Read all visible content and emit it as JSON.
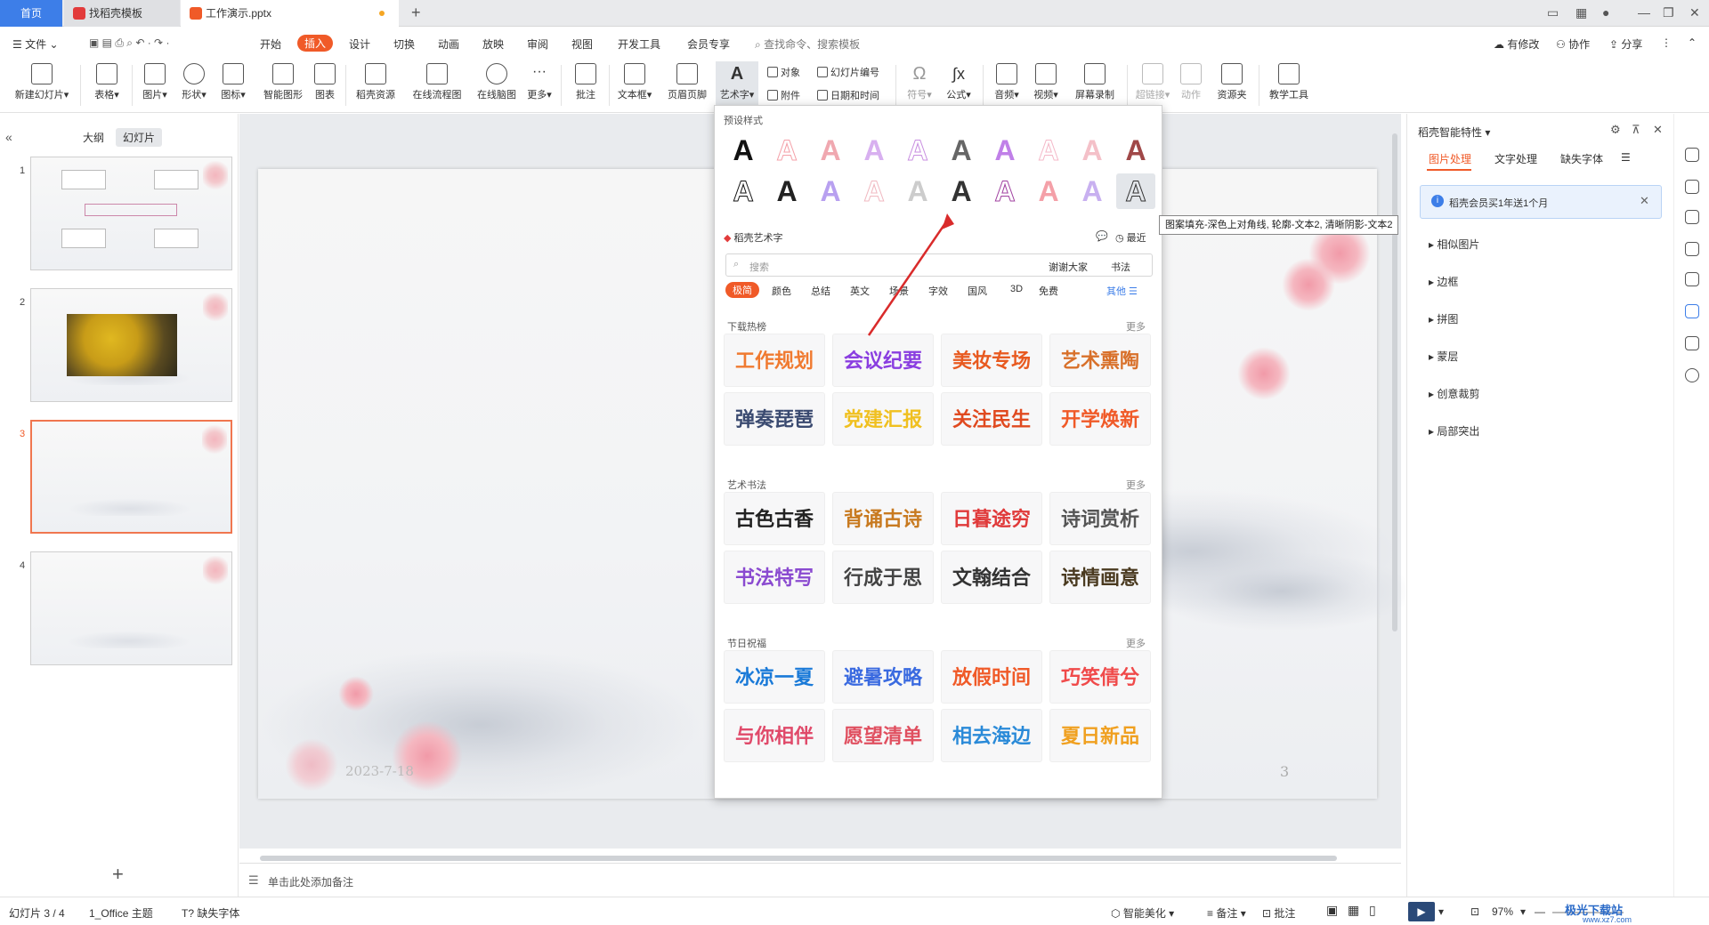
{
  "tabs": {
    "home": "首页",
    "t1": "找稻壳模板",
    "t2": "工作演示.pptx"
  },
  "menubar": {
    "file": "文件",
    "items": [
      "开始",
      "插入",
      "设计",
      "切换",
      "动画",
      "放映",
      "审阅",
      "视图",
      "开发工具",
      "会员专享"
    ],
    "search_placeholder": "查找命令、搜索模板",
    "modified": "有修改",
    "collab": "协作",
    "share": "分享"
  },
  "ribbon": {
    "new_slide": "新建幻灯片",
    "table": "表格",
    "image": "图片",
    "shape": "形状",
    "icon": "图标",
    "smart_graphic": "智能图形",
    "chart": "图表",
    "docer_res": "稻壳资源",
    "online_flow": "在线流程图",
    "online_mind": "在线脑图",
    "more": "更多",
    "comment": "批注",
    "textbox": "文本框",
    "header_footer": "页眉页脚",
    "wordart": "艺术字",
    "object": "对象",
    "attachment": "附件",
    "slide_number": "幻灯片编号",
    "datetime": "日期和时间",
    "symbol": "符号",
    "formula": "公式",
    "audio": "音频",
    "video": "视频",
    "screen_rec": "屏幕录制",
    "hyperlink": "超链接",
    "action": "动作",
    "resource": "资源夹",
    "teach_tool": "教学工具"
  },
  "leftpanel": {
    "tab_outline": "大纲",
    "tab_slides": "幻灯片",
    "slide_numbers": [
      "1",
      "2",
      "3",
      "4"
    ],
    "add_slide": "+"
  },
  "slide": {
    "date": "2023-7-18",
    "page_number": "3"
  },
  "notes": {
    "placeholder": "单击此处添加备注"
  },
  "dropdown": {
    "preset_title": "预设样式",
    "docer_title": "稻壳艺术字",
    "recent": "最近",
    "search_placeholder": "搜索",
    "search_btn1": "谢谢大家",
    "search_btn2": "书法",
    "categories": [
      "极简",
      "颜色",
      "总结",
      "英文",
      "场景",
      "字效",
      "国风",
      "3D",
      "免费"
    ],
    "other": "其他",
    "sections": [
      {
        "title": "下载热榜",
        "more": "更多",
        "cards": [
          "工作规划",
          "会议纪要",
          "美妆专场",
          "艺术熏陶",
          "弹奏琵琶",
          "党建汇报",
          "关注民生",
          "开学焕新"
        ]
      },
      {
        "title": "艺术书法",
        "more": "更多",
        "cards": [
          "古色古香",
          "背诵古诗",
          "日暮途穷",
          "诗词赏析",
          "书法特写",
          "行成于思",
          "文翰结合",
          "诗情画意"
        ]
      },
      {
        "title": "节日祝福",
        "more": "更多",
        "cards": [
          "冰凉一夏",
          "避暑攻略",
          "放假时间",
          "巧笑倩兮",
          "与你相伴",
          "愿望清单",
          "相去海边",
          "夏日新品"
        ]
      }
    ],
    "tooltip": "图案填充-深色上对角线, 轮廓-文本2, 清晰阴影-文本2",
    "preset_letter": "A",
    "preset_colors": [
      "#111111",
      "#f4a0a8",
      "#f0a8b0",
      "#d8b0f0",
      "#c88ee0",
      "#666666",
      "#c080e8",
      "#f4b8c8",
      "#f4c0c8",
      "#a04848",
      "#111111",
      "#222222",
      "#b8a0f0",
      "#f0b8c0",
      "#cccccc",
      "#333333",
      "#a040a0",
      "#f4a0a8",
      "#c8b0f0",
      "#333333"
    ]
  },
  "rightpanel": {
    "title": "稻壳智能特性",
    "tabs": [
      "图片处理",
      "文字处理",
      "缺失字体"
    ],
    "banner": "稻壳会员买1年送1个月",
    "items": [
      "相似图片",
      "边框",
      "拼图",
      "蒙层",
      "创意裁剪",
      "局部突出"
    ]
  },
  "status": {
    "slide_info": "幻灯片 3 / 4",
    "theme": "1_Office 主题",
    "missing_font": "缺失字体",
    "beautify": "智能美化",
    "notes": "备注",
    "comment": "批注",
    "zoom": "97%",
    "watermark": "极光下载站",
    "watermark_url": "www.xz7.com"
  }
}
